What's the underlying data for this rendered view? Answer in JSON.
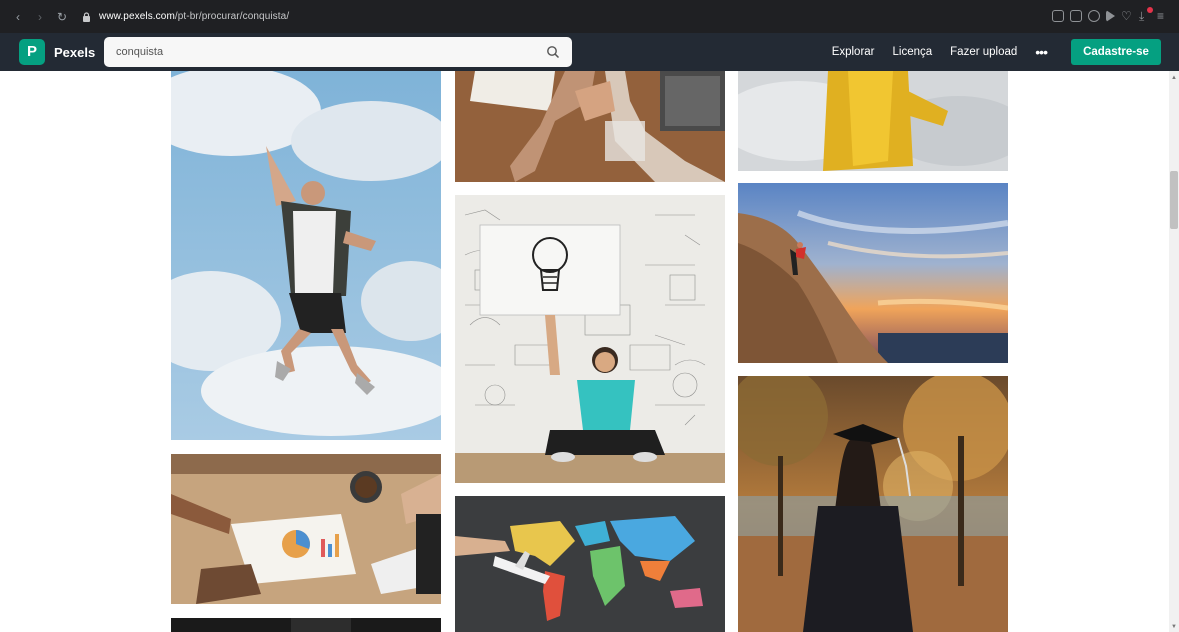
{
  "browser": {
    "back_icon": "chevron-left-icon",
    "forward_icon": "chevron-right-icon",
    "reload_icon": "reload-icon",
    "url_domain": "www.pexels.com",
    "url_path": "/pt-br/procurar/conquista/"
  },
  "header": {
    "logo_letter": "P",
    "logo_text": "Pexels",
    "search_value": "conquista",
    "nav": [
      "Explorar",
      "Licença",
      "Fazer upload"
    ],
    "more_label": "•••",
    "signup_label": "Cadastre-se",
    "accent_color": "#05a081",
    "bg_color": "#232a34"
  },
  "photos": [
    {
      "column": 1,
      "subject": "man-jumping-sky"
    },
    {
      "column": 1,
      "subject": "business-meeting-charts"
    },
    {
      "column": 1,
      "subject": "dark-photo"
    },
    {
      "column": 2,
      "subject": "team-hands-stacked"
    },
    {
      "column": 2,
      "subject": "woman-lightbulb-sign"
    },
    {
      "column": 2,
      "subject": "world-map-airplane"
    },
    {
      "column": 3,
      "subject": "yellow-jacket-sky"
    },
    {
      "column": 3,
      "subject": "climber-sunset-rock"
    },
    {
      "column": 3,
      "subject": "graduate-autumn-park"
    }
  ]
}
